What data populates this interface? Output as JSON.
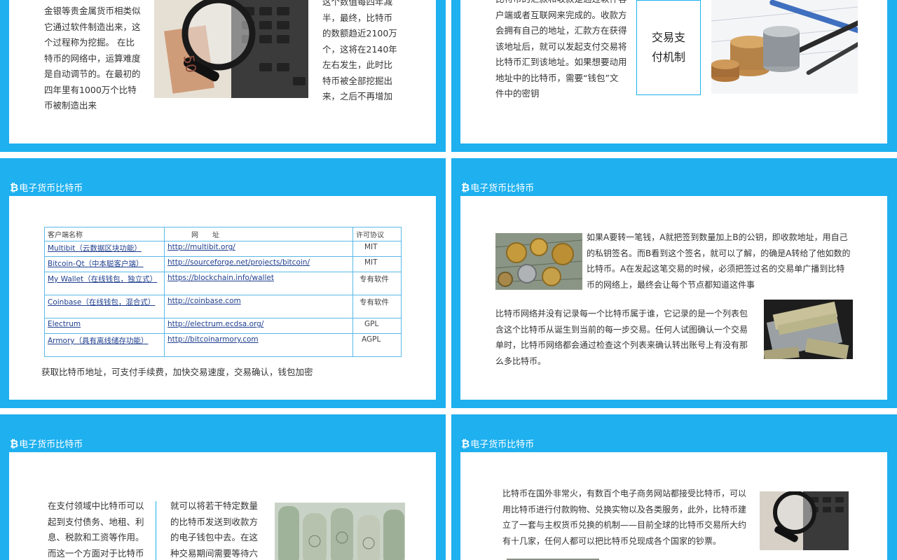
{
  "slide_title": "电子货币比特币",
  "bitcoin_symbol": "₿",
  "colors": {
    "frame": "#1eb0ef",
    "card": "#ffffff",
    "link": "#1f3f8f"
  },
  "slide1": {
    "left_text": "金银等贵金属货币相类似\n它通过软件制造出来，这\n个过程称为挖掘。 在比\n特币的网络中，运算难度\n是自动调节的。在最初的\n四年里有1000万个比特\n币被制造出来",
    "right_text": "这个数值每四年减\n半，最终，比特币\n的数额趋近2100万\n个，这将在2140年\n左右发生，此时比\n特币被全部挖掘出\n来，之后不再增加"
  },
  "slide2": {
    "text": "比特币的汇款和收款是通过软件客\n户端或者互联网来完成的。收款方\n会拥有自己的地址，汇款方在获得\n该地址后，就可以发起支付交易将\n比特币汇到该地址。如果想要动用\n地址中的比特币，需要“钱包”文\n件中的密钥",
    "box_label": "交易支\n付机制"
  },
  "slide3": {
    "table": {
      "headers": [
        "客户端名称",
        "网　　址",
        "许可协议"
      ],
      "rows": [
        {
          "name": "Multibit（云数据区块功能）",
          "url": "http://multibit.org/",
          "license": "MIT"
        },
        {
          "name": "Bitcoin-Qt（中本聪客户端）",
          "url": "http://sourceforge.net/projects/bitcoin/",
          "license": "MIT"
        },
        {
          "name": "My Wallet（在线钱包，独立式）",
          "url": "https://blockchain.info/wallet",
          "license": "专有软件"
        },
        {
          "name": "Coinbase（在线钱包，混合式）",
          "url": "http://coinbase.com",
          "license": "专有软件"
        },
        {
          "name": "Electrum",
          "url": "http://electrum.ecdsa.org/",
          "license": "GPL"
        },
        {
          "name": "Armory（具有离线储存功能）",
          "url": "http://bitcoinarmory.com",
          "license": "AGPL"
        }
      ]
    },
    "caption": "获取比特币地址，可支付手续费，加快交易速度，交易确认，钱包加密"
  },
  "slide4": {
    "text1": "如果A要转一笔钱，A就把签到数量加上B的公钥，即收款地址，用自己\n的私钥签名。而B看到这个签名，就可以了解，的确是A转给了他如数的\n比特币。A在发起这笔交易的时候，必须把签过名的交易单广播到比特\n币的网络上，最终会让每个节点都知道这件事",
    "text2": "比特币网络并没有记录每一个比特币属于谁，它记录的是一个列表包\n含这个比特币从诞生到当前的每一步交易。任何人试图确认一个交易\n单时，比特币网络都会通过检查这个列表来确认转出账号上有没有那\n么多比特币。"
  },
  "slide5": {
    "left_text": "在支付领域中比特币可以\n起到支付债务、地租、利\n息、税款和工资等作用。\n而这一个方面对于比特币",
    "right_text": "就可以将若干特定数量\n的比特币发送到收款方\n的电子钱包中去。在这\n种交易期间需要等待六"
  },
  "slide6": {
    "text": "比特币在国外非常火，有数百个电子商务网站都接受比特币，可以\n用比特币进行付款购物、兑换实物以及各类服务，此外，比特币建\n立了一套与主权货币兑换的机制——目前全球的比特币交易所大约\n有十几家，任何人都可以把比特币兑现成各个国家的钞票。"
  }
}
